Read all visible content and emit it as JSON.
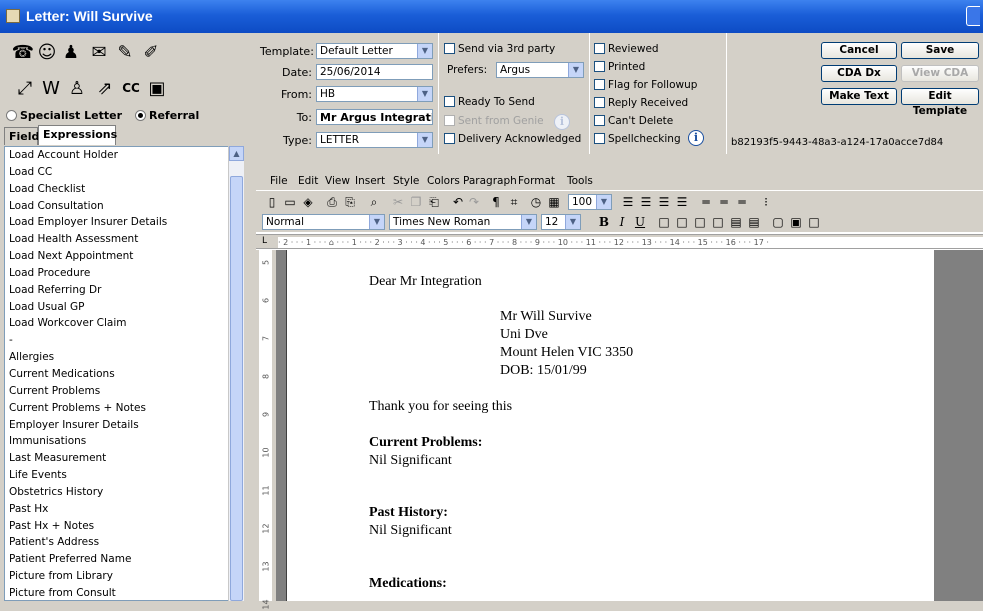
{
  "window": {
    "title": "Letter: Will Survive"
  },
  "left": {
    "radios": [
      {
        "label": "Specialist Letter",
        "selected": false
      },
      {
        "label": "Referral",
        "selected": true
      }
    ],
    "tabs": [
      "Fields",
      "Expressions"
    ],
    "list_items": [
      "Load Account Holder",
      "Load CC",
      "Load Checklist",
      "Load Consultation",
      "Load Employer Insurer Details",
      "Load Health Assessment",
      "Load Next Appointment",
      "Load Procedure",
      "Load Referring Dr",
      "Load Usual GP",
      "Load Workcover Claim",
      "-",
      "Allergies",
      "Current Medications",
      "Current Problems",
      "Current Problems + Notes",
      "Employer Insurer Details",
      "Immunisations",
      "Last Measurement",
      "Life Events",
      "Obstetrics History",
      "Past Hx",
      "Past Hx + Notes",
      "Patient's Address",
      "Patient Preferred Name",
      "Picture from Library",
      "Picture from Consult"
    ]
  },
  "form": {
    "template_label": "Template:",
    "template_value": "Default Letter",
    "date_label": "Date:",
    "date_value": "25/06/2014",
    "from_label": "From:",
    "from_value": "HB",
    "to_label": "To:",
    "to_value": "Mr Argus Integration",
    "type_label": "Type:",
    "type_value": "LETTER",
    "send_3rd_party": "Send via 3rd party",
    "prefers_label": "Prefers:",
    "prefers_value": "Argus",
    "ready_to_send": "Ready To Send",
    "sent_from_genie": "Sent from Genie",
    "delivery_ack": "Delivery Acknowledged",
    "reviewed": "Reviewed",
    "printed": "Printed",
    "flag_followup": "Flag for Followup",
    "reply_received": "Reply Received",
    "cant_delete": "Can't Delete",
    "spellchecking": "Spellchecking",
    "buttons": {
      "cancel": "Cancel",
      "save": "Save",
      "cda_dx": "CDA Dx",
      "view_cda": "View CDA",
      "make_text": "Make Text",
      "edit_template": "Edit Template"
    },
    "guid": "b82193f5-9443-48a3-a124-17a0acce7d84"
  },
  "editor": {
    "menu": [
      "File",
      "Edit",
      "View",
      "Insert",
      "Style",
      "Colors",
      "Paragraph",
      "Format",
      "Tools"
    ],
    "zoom": "100",
    "style": "Normal",
    "font": "Times New Roman",
    "size": "12",
    "ruler_text": "· 2 · · · 1 · · · ⌂ · · · 1 · · · 2 · · · 3 · · · 4 · · · 5 · · · 6 · · · 7 · · · 8 · · · 9 · · · 10 · · · 11 · · · 12 · · · 13 · · · 14 · · · 15 · · · 16 · · · 17 ·",
    "vruler_numbers": [
      "5",
      "6",
      "7",
      "8",
      "9",
      "10",
      "11",
      "12",
      "13",
      "14"
    ]
  },
  "document": {
    "salutation": "Dear Mr Integration",
    "address": [
      "Mr Will Survive",
      "Uni Dve",
      "Mount Helen VIC 3350",
      "DOB: 15/01/99"
    ],
    "intro": "Thank you for seeing this",
    "h_current": "Current Problems:",
    "current": "Nil Significant",
    "h_past": "Past History:",
    "past": "Nil Significant",
    "h_meds": "Medications:"
  }
}
